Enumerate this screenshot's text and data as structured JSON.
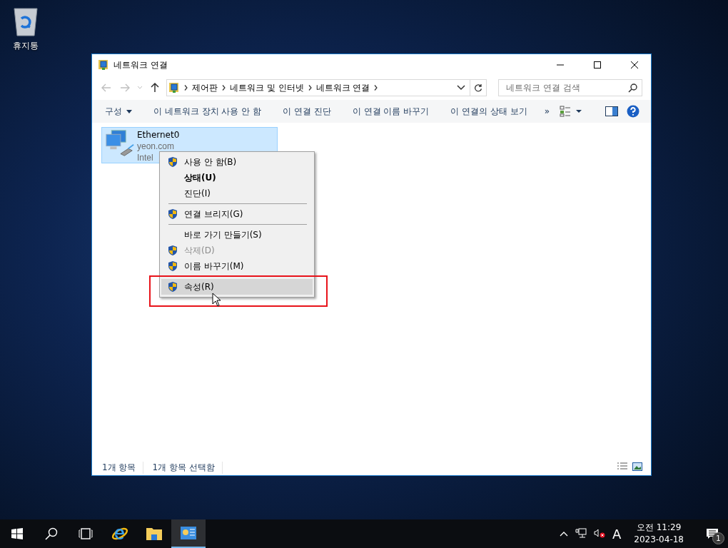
{
  "desktop_icons": [
    {
      "label": "휴지통"
    }
  ],
  "window": {
    "title": "네트워크 연결",
    "breadcrumb": [
      "제어판",
      "네트워크 및 인터넷",
      "네트워크 연결"
    ],
    "search": {
      "placeholder": "네트워크 연결 검색"
    },
    "toolbar": [
      {
        "label": "구성",
        "kind": "dropdown"
      },
      {
        "label": "이 네트워크 장치 사용 안 함",
        "kind": "command"
      },
      {
        "label": "이 연결 진단",
        "kind": "command"
      },
      {
        "label": "이 연결 이름 바꾸기",
        "kind": "command"
      },
      {
        "label": "이 연결의 상태 보기",
        "kind": "command"
      }
    ],
    "toolbar_overflow": "»",
    "connections": [
      {
        "name": "Ethernet0",
        "domain": "yeon.com",
        "adapter": "Intel",
        "selected": true
      }
    ],
    "status_bar": [
      "1개 항목",
      "1개 항목 선택함"
    ]
  },
  "context_menu": {
    "items": [
      {
        "kind": "item",
        "label": "사용 안 함(B)",
        "shield": true,
        "bold": false,
        "disabled": false,
        "selected": false
      },
      {
        "kind": "item",
        "label": "상태(U)",
        "shield": false,
        "bold": true,
        "disabled": false,
        "selected": false
      },
      {
        "kind": "item",
        "label": "진단(I)",
        "shield": false,
        "bold": false,
        "disabled": false,
        "selected": false
      },
      {
        "kind": "separator"
      },
      {
        "kind": "item",
        "label": "연결 브리지(G)",
        "shield": true,
        "bold": false,
        "disabled": false,
        "selected": false
      },
      {
        "kind": "separator"
      },
      {
        "kind": "item",
        "label": "바로 가기 만들기(S)",
        "shield": false,
        "bold": false,
        "disabled": false,
        "selected": false
      },
      {
        "kind": "item",
        "label": "삭제(D)",
        "shield": true,
        "bold": false,
        "disabled": true,
        "selected": false
      },
      {
        "kind": "item",
        "label": "이름 바꾸기(M)",
        "shield": true,
        "bold": false,
        "disabled": false,
        "selected": false
      },
      {
        "kind": "separator"
      },
      {
        "kind": "item",
        "label": "속성(R)",
        "shield": true,
        "bold": false,
        "disabled": false,
        "selected": true
      }
    ]
  },
  "taskbar": {
    "apps": [
      {
        "kind": "ie",
        "selected": false
      },
      {
        "kind": "explorer",
        "selected": false
      },
      {
        "kind": "network",
        "selected": true
      }
    ],
    "ime": "A",
    "time": "오전 11:29",
    "date": "2023-04-18",
    "notification_count": "1"
  }
}
